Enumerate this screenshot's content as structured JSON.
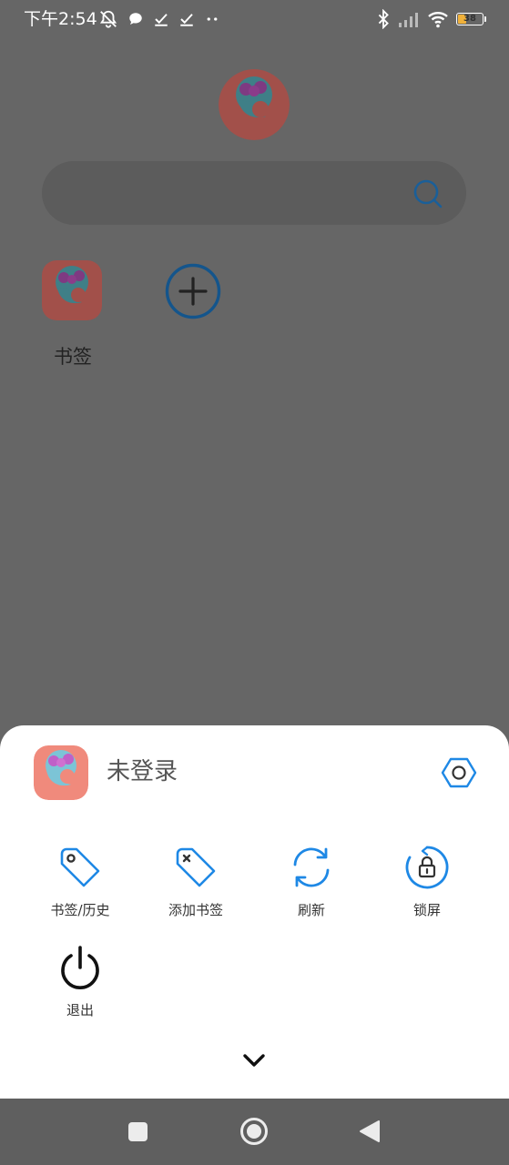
{
  "status_bar": {
    "time": "下午2:54",
    "battery_level": "38",
    "battery_fraction": 0.38,
    "left_icons": [
      "mute-alarm-icon",
      "chat-bubble-icon",
      "download-done-icon",
      "download-done-icon",
      "more-dots-icon"
    ],
    "right_icons": [
      "bluetooth-icon",
      "cellular-signal-icon",
      "wifi-icon",
      "battery-icon"
    ]
  },
  "home": {
    "search": {
      "placeholder": ""
    },
    "shortcuts": [
      {
        "label": "书签",
        "icon": "app-logo"
      },
      {
        "label": "",
        "icon": "add-circle-icon"
      }
    ]
  },
  "sheet": {
    "user_status": "未登录",
    "actions": [
      {
        "label": "书签/历史",
        "icon": "tag-icon"
      },
      {
        "label": "添加书签",
        "icon": "tag-add-icon"
      },
      {
        "label": "刷新",
        "icon": "refresh-icon"
      },
      {
        "label": "锁屏",
        "icon": "lock-rotate-icon"
      },
      {
        "label": "退出",
        "icon": "power-icon"
      }
    ]
  },
  "colors": {
    "overlay": "#666666",
    "accent_blue": "#1e88e5",
    "sheet_bg": "#ffffff",
    "battery": "#f0b13a"
  },
  "nav_bar": {
    "buttons": [
      "recent-apps-icon",
      "home-icon",
      "back-icon"
    ]
  }
}
